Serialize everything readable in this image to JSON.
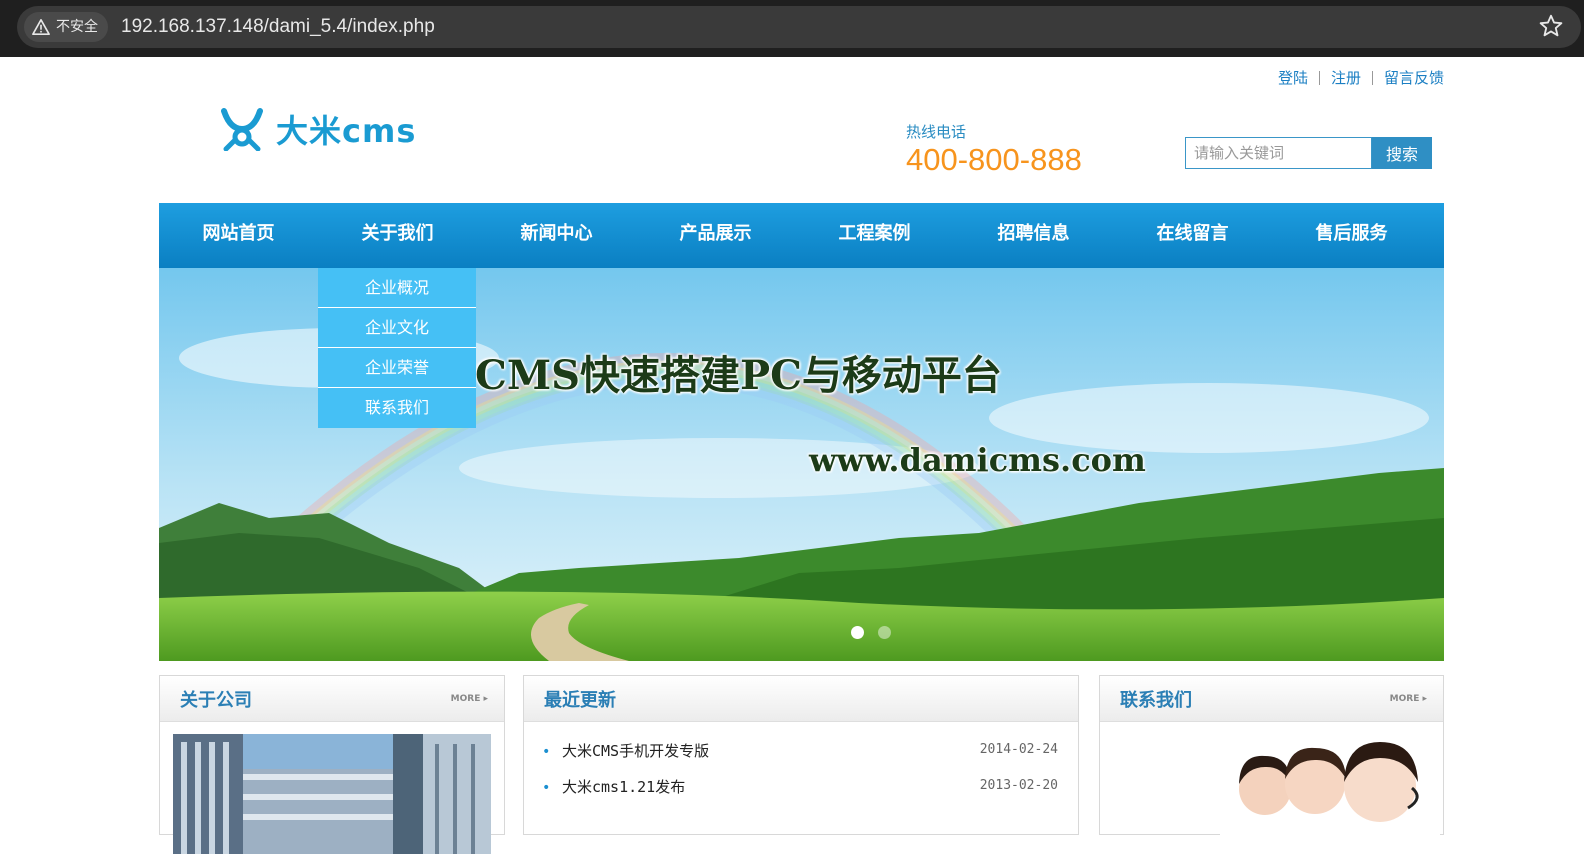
{
  "browser": {
    "security_label": "不安全",
    "url": "192.168.137.148/dami_5.4/index.php"
  },
  "top_links": [
    "登陆",
    "注册",
    "留言反馈"
  ],
  "logo": {
    "text": "大米cms"
  },
  "hotline": {
    "label": "热线电话",
    "number": "400-800-888"
  },
  "search": {
    "placeholder": "请输入关键词",
    "button_label": "搜索"
  },
  "nav": {
    "items": [
      "网站首页",
      "关于我们",
      "新闻中心",
      "产品展示",
      "工程案例",
      "招聘信息",
      "在线留言",
      "售后服务"
    ]
  },
  "dropdown": {
    "items": [
      "企业概况",
      "企业文化",
      "企业荣誉",
      "联系我们"
    ]
  },
  "hero": {
    "title": "CMS快速搭建PC与移动平台",
    "url": "www.damicms.com",
    "slides_total": 2,
    "active_slide": 1
  },
  "panels": {
    "about": {
      "title": "关于公司",
      "more": "MORE ▸"
    },
    "news": {
      "title": "最近更新",
      "items": [
        {
          "title": "大米CMS手机开发专版",
          "date": "2014-02-24"
        },
        {
          "title": "大米cms1.21发布",
          "date": "2013-02-20"
        }
      ]
    },
    "contact": {
      "title": "联系我们",
      "more": "MORE ▸"
    }
  },
  "colors": {
    "brand_blue": "#1a9bd2",
    "nav_blue": "#0a7fc2",
    "hotline_orange": "#f7941d",
    "dropdown_blue": "#45c0f5"
  }
}
